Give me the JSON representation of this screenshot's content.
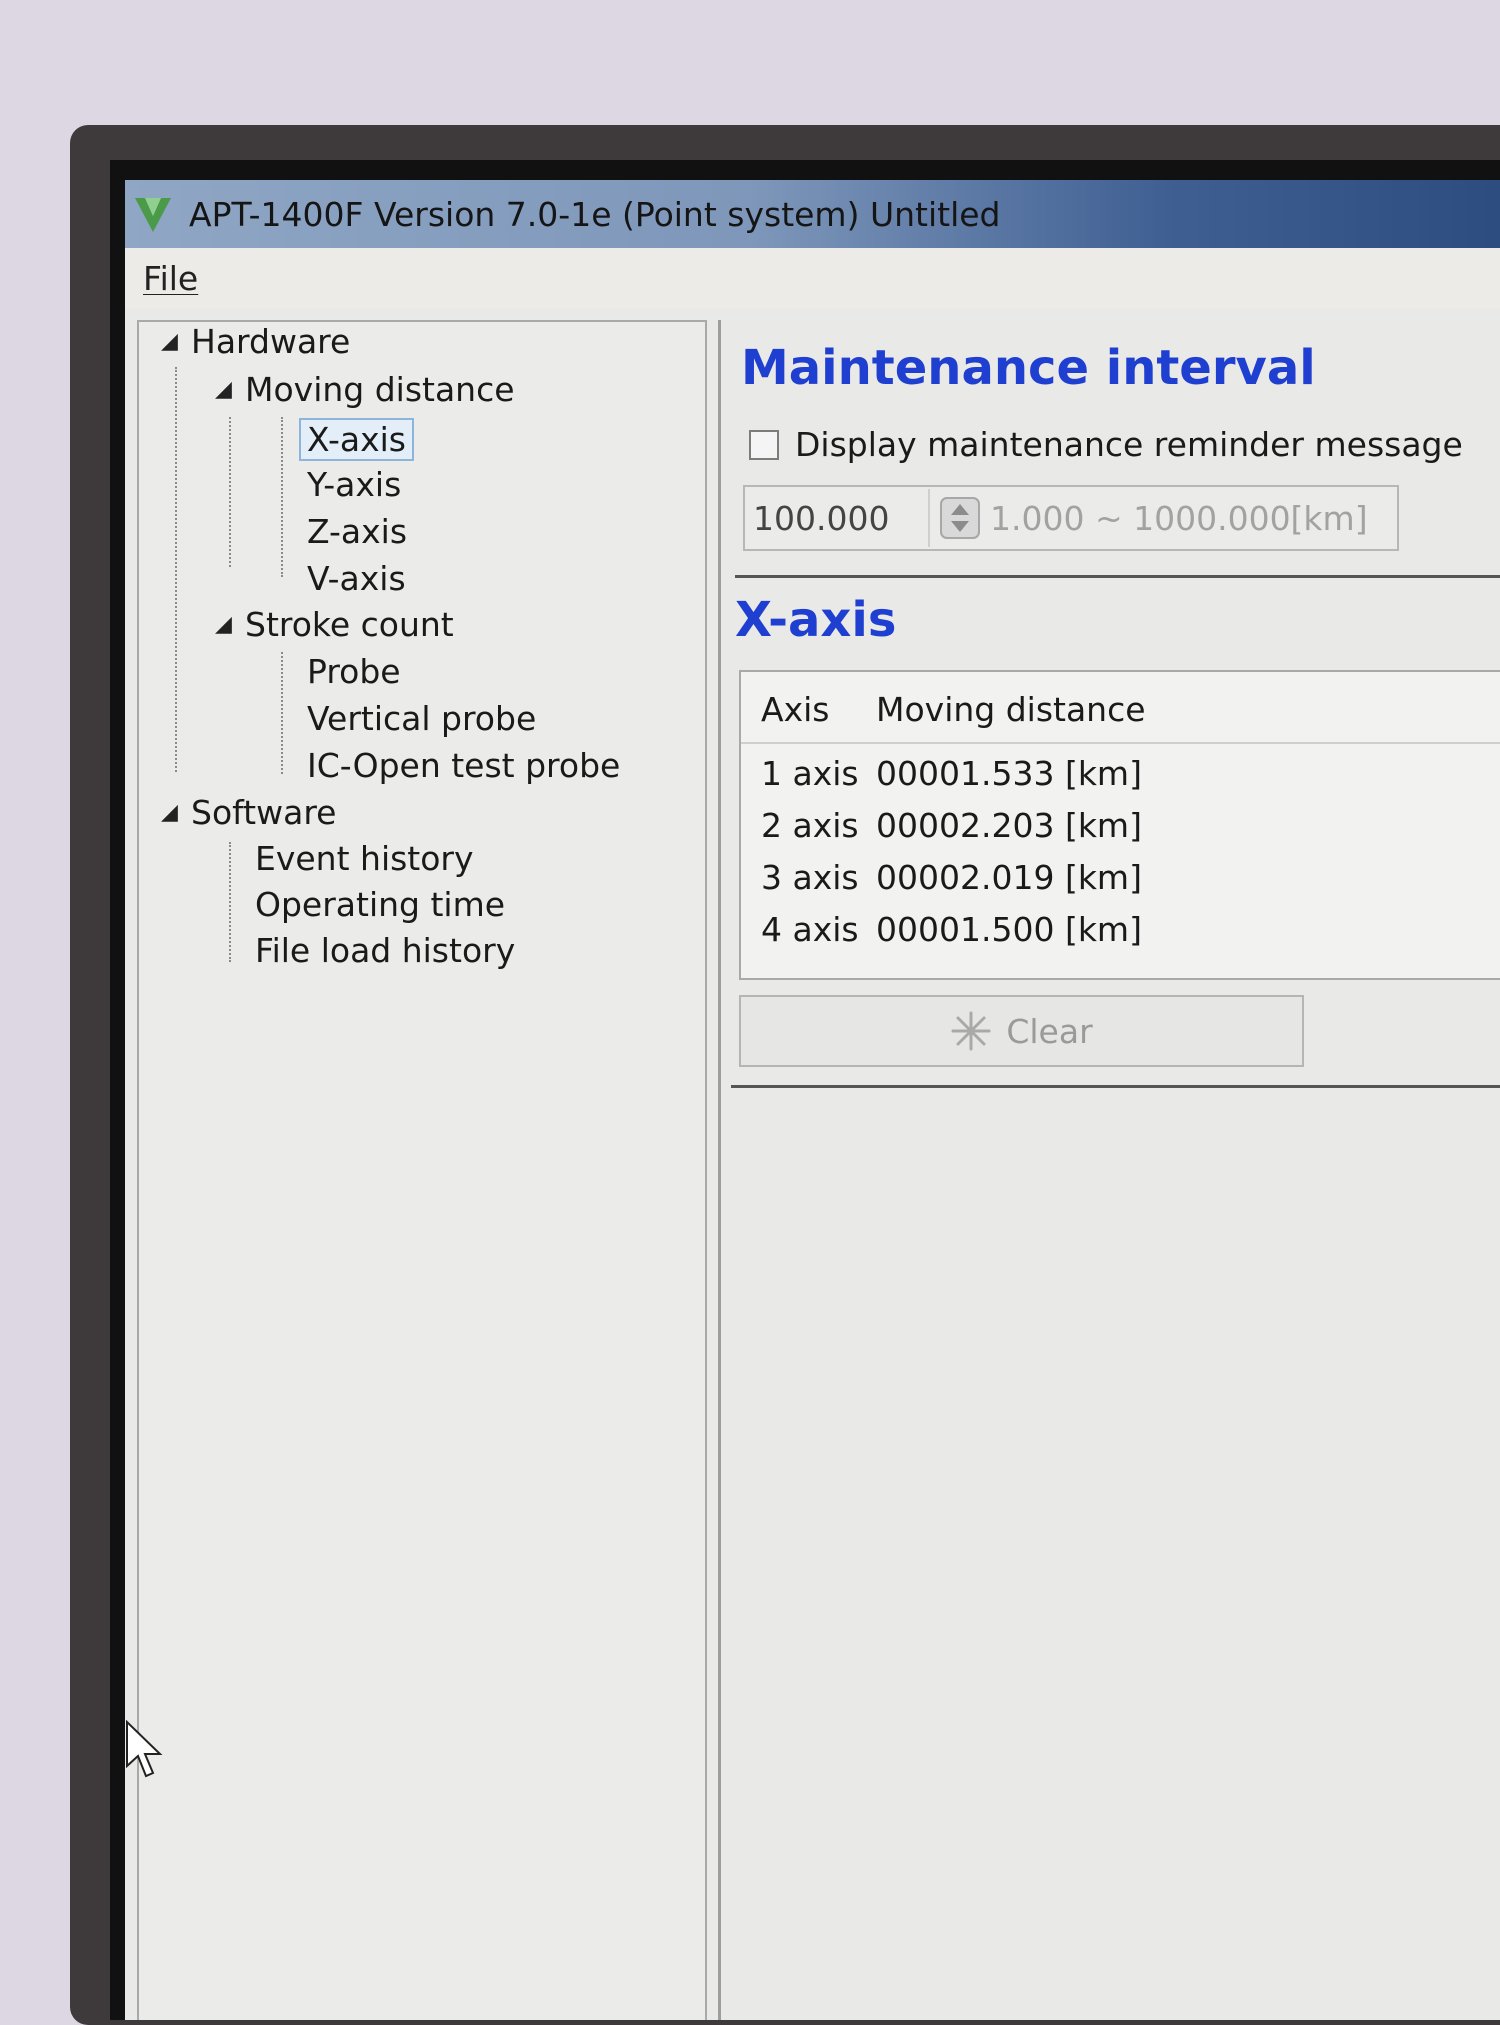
{
  "window": {
    "title": "APT-1400F Version 7.0-1e  (Point system) Untitled"
  },
  "menu": {
    "file_label": "File"
  },
  "tree": {
    "hardware": "Hardware",
    "moving_distance": "Moving distance",
    "x_axis": "X-axis",
    "y_axis": "Y-axis",
    "z_axis": "Z-axis",
    "v_axis": "V-axis",
    "stroke_count": "Stroke count",
    "probe": "Probe",
    "vertical_probe": "Vertical probe",
    "ic_open_probe": "IC-Open test probe",
    "software": "Software",
    "event_history": "Event history",
    "operating_time": "Operating time",
    "file_load_history": "File load history",
    "selected": "X-axis"
  },
  "maintenance": {
    "heading": "Maintenance interval",
    "checkbox_label": "Display maintenance reminder message",
    "checkbox_checked": false,
    "interval_value": "100.000",
    "range_text": "1.000 ~ 1000.000[km]"
  },
  "axis_section": {
    "heading": "X-axis",
    "columns": [
      "Axis",
      "Moving distance"
    ],
    "rows": [
      {
        "axis": "1 axis",
        "distance": "00001.533 [km]"
      },
      {
        "axis": "2 axis",
        "distance": "00002.203 [km]"
      },
      {
        "axis": "3 axis",
        "distance": "00002.019 [km]"
      },
      {
        "axis": "4 axis",
        "distance": "00001.500 [km]"
      }
    ],
    "clear_label": "Clear"
  },
  "colors": {
    "heading_blue": "#1f3fd0",
    "titlebar_dark": "#2c4b7f"
  }
}
